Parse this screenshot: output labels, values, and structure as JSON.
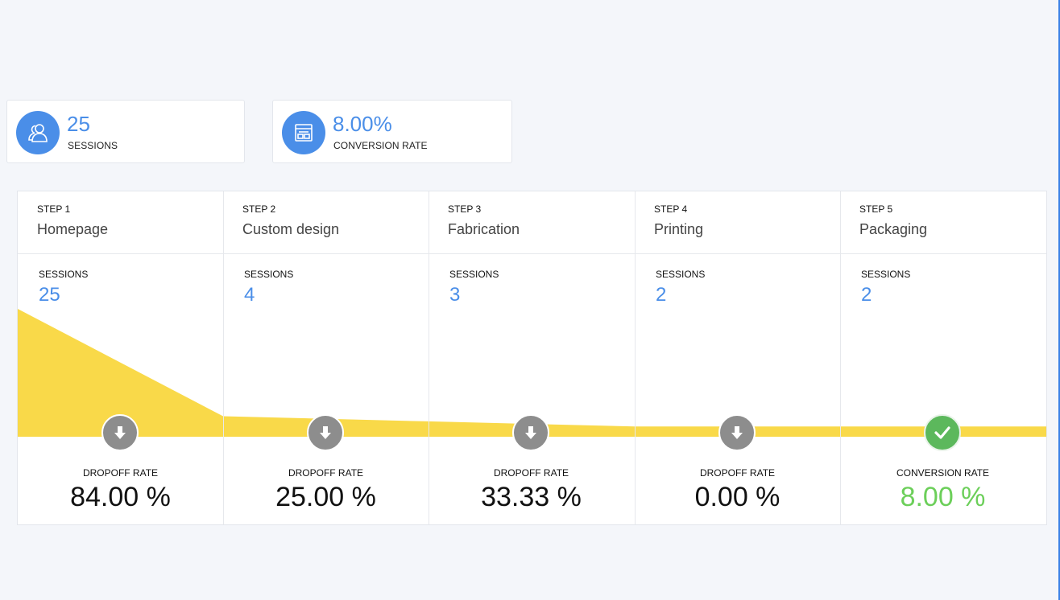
{
  "summary": {
    "sessions": {
      "value": "25",
      "label": "SESSIONS",
      "icon": "users-icon"
    },
    "conversion": {
      "value": "8.00%",
      "label": "CONVERSION RATE",
      "icon": "browser-window-icon"
    }
  },
  "funnel": {
    "steps": [
      {
        "step": "STEP 1",
        "name": "Homepage",
        "sessions_label": "SESSIONS",
        "sessions": "25",
        "rate_label": "DROPOFF RATE",
        "rate": "84.00 %",
        "badge": "arrow-down-icon"
      },
      {
        "step": "STEP 2",
        "name": "Custom design",
        "sessions_label": "SESSIONS",
        "sessions": "4",
        "rate_label": "DROPOFF RATE",
        "rate": "25.00 %",
        "badge": "arrow-down-icon"
      },
      {
        "step": "STEP 3",
        "name": "Fabrication",
        "sessions_label": "SESSIONS",
        "sessions": "3",
        "rate_label": "DROPOFF RATE",
        "rate": "33.33 %",
        "badge": "arrow-down-icon"
      },
      {
        "step": "STEP 4",
        "name": "Printing",
        "sessions_label": "SESSIONS",
        "sessions": "2",
        "rate_label": "DROPOFF RATE",
        "rate": "0.00 %",
        "badge": "arrow-down-icon"
      },
      {
        "step": "STEP 5",
        "name": "Packaging",
        "sessions_label": "SESSIONS",
        "sessions": "2",
        "rate_label": "CONVERSION RATE",
        "rate": "8.00 %",
        "badge": "checkmark-icon"
      }
    ],
    "session_counts": [
      25,
      4,
      3,
      2,
      2
    ],
    "fill_color": "#f9d949"
  },
  "colors": {
    "accent": "#4a8ee8",
    "success": "#6ccf5a",
    "badge_gray": "#8d8d8d",
    "badge_green": "#5cb85c"
  }
}
